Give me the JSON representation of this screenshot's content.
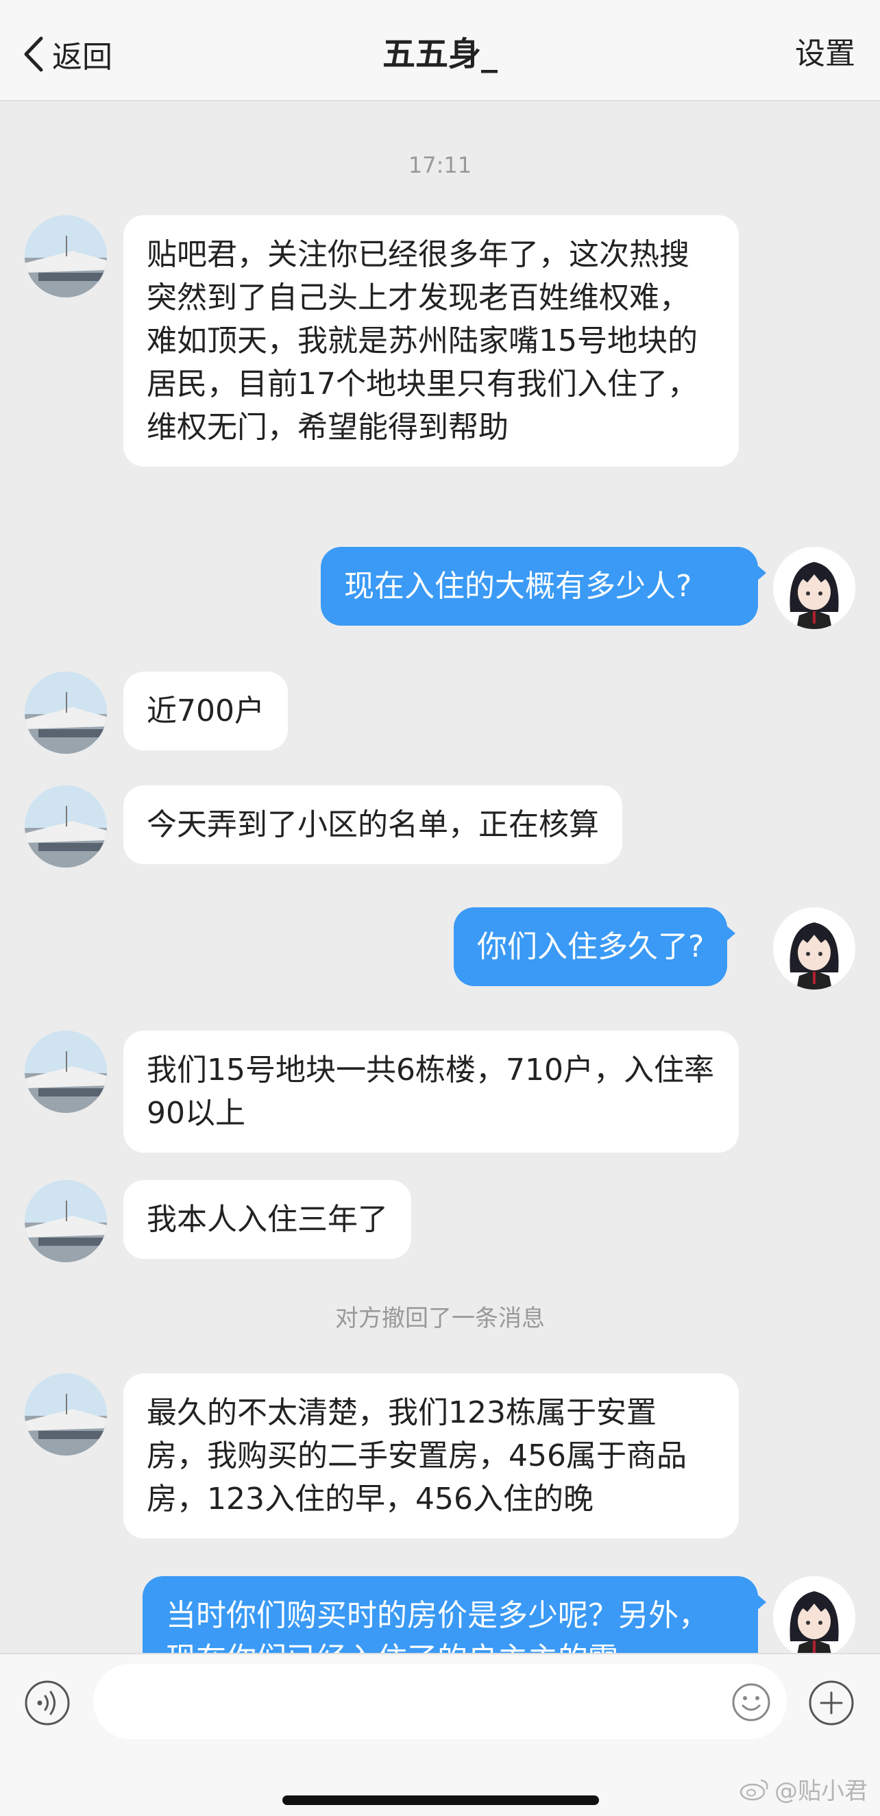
{
  "header": {
    "back_label": "返回",
    "title": "五五身_",
    "settings_label": "设置"
  },
  "chat": {
    "timestamp": "17:11",
    "messages": [
      {
        "side": "left",
        "text": "贴吧君，关注你已经很多年了，这次热搜突然到了自己头上才发现老百姓维权难，难如顶天，我就是苏州陆家嘴15号地块的居民，目前17个地块里只有我们入住了，维权无门，希望能得到帮助"
      },
      {
        "side": "right",
        "text": "现在入住的大概有多少人?"
      },
      {
        "side": "left",
        "text": "近700户"
      },
      {
        "side": "left",
        "text": "今天弄到了小区的名单，正在核算"
      },
      {
        "side": "right",
        "text": "你们入住多久了?"
      },
      {
        "side": "left",
        "text": "我们15号地块一共6栋楼，710户，入住率90以上"
      },
      {
        "side": "left",
        "text": "我本人入住三年了"
      },
      {
        "side": "left",
        "text": "最久的不太清楚，我们123栋属于安置房，我购买的二手安置房，456属于商品房，123入住的早，456入住的晚"
      },
      {
        "side": "right",
        "text": "当时你们购买时的房价是多少呢？另外，现在你们已经入住了的户主主的需"
      }
    ],
    "recall_notice": "对方撤回了一条消息"
  },
  "input_bar": {
    "placeholder": "",
    "voice_icon": "voice-icon",
    "emoji_icon": "emoji-icon",
    "plus_icon": "plus-icon"
  },
  "watermark": "@贴小君",
  "colors": {
    "background": "#ececec",
    "header": "#f7f7f7",
    "bubble_right": "#3a9af5",
    "bubble_left": "#ffffff"
  }
}
